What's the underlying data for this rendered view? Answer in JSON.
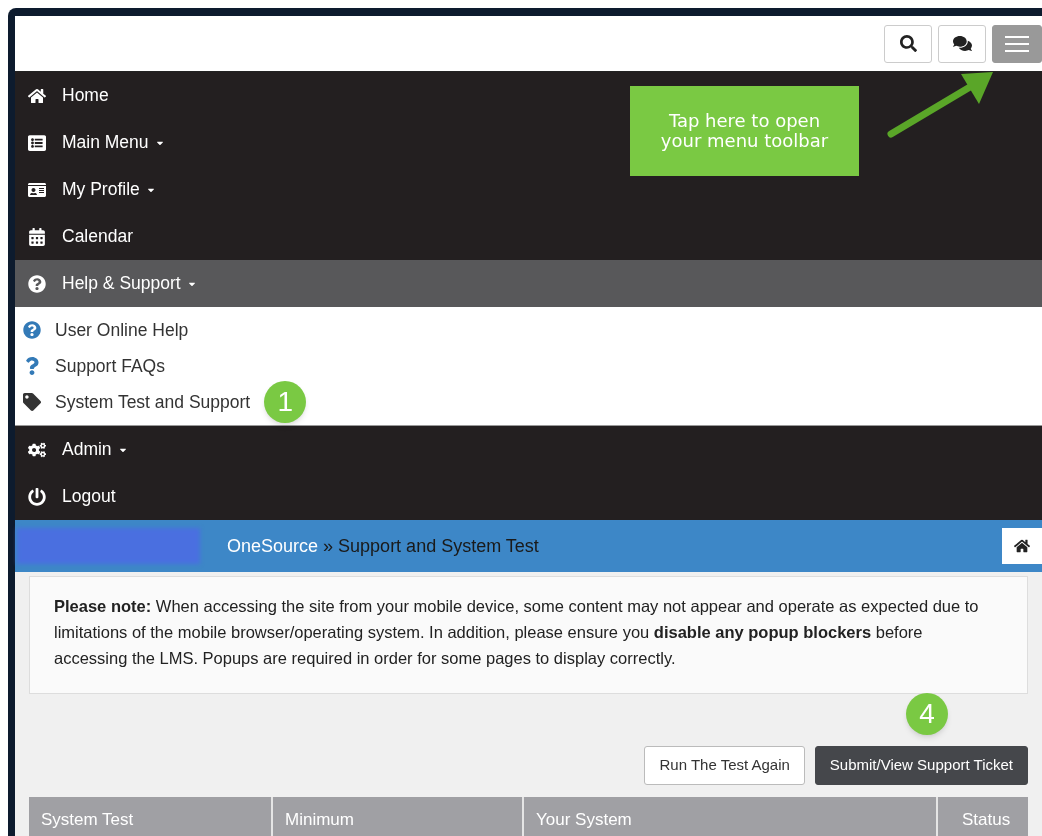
{
  "header": {
    "buttons": [
      {
        "kind": "search",
        "selected": false
      },
      {
        "kind": "chat",
        "selected": false
      },
      {
        "kind": "menu",
        "selected": true
      }
    ]
  },
  "nav": [
    {
      "label": "Home",
      "kind": "home",
      "has_menu": false,
      "expanded": false
    },
    {
      "label": "Main Menu",
      "kind": "list",
      "has_menu": true,
      "expanded": false
    },
    {
      "label": "My Profile",
      "kind": "profile",
      "has_menu": true,
      "expanded": false
    },
    {
      "label": "Calendar",
      "kind": "calendar",
      "has_menu": false,
      "expanded": false
    },
    {
      "label": "Help & Support",
      "kind": "help",
      "has_menu": true,
      "expanded": true,
      "children": [
        {
          "label": "User Online Help",
          "kind": "help"
        },
        {
          "label": "Support FAQs",
          "kind": "question"
        },
        {
          "label": "System Test and Support",
          "kind": "tag",
          "step": "1"
        }
      ]
    },
    {
      "label": "Admin",
      "kind": "cogs",
      "has_menu": true,
      "expanded": false
    },
    {
      "label": "Logout",
      "kind": "power",
      "has_menu": false,
      "expanded": false
    }
  ],
  "callout": {
    "text": "Tap here to open your menu toolbar"
  },
  "breadcrumb": {
    "separator": "»",
    "items": [
      "OneSource",
      "Support and System Test"
    ]
  },
  "note": "**Please note:** When accessing the site from your mobile device, some content may not appear and operate as expected due to limitations of the mobile browser/operating system. In addition, please ensure you **disable any popup blockers** before accessing the LMS. Popups are required in order for some pages to display correctly.",
  "actions": {
    "step": "4",
    "buttons": [
      {
        "label": "Run The Test Again",
        "kind": "default"
      },
      {
        "label": "Submit/View Support Ticket",
        "kind": "dark"
      }
    ]
  },
  "table": {
    "columns": [
      "System Test",
      "Minimum",
      "Your System",
      "Status"
    ]
  }
}
